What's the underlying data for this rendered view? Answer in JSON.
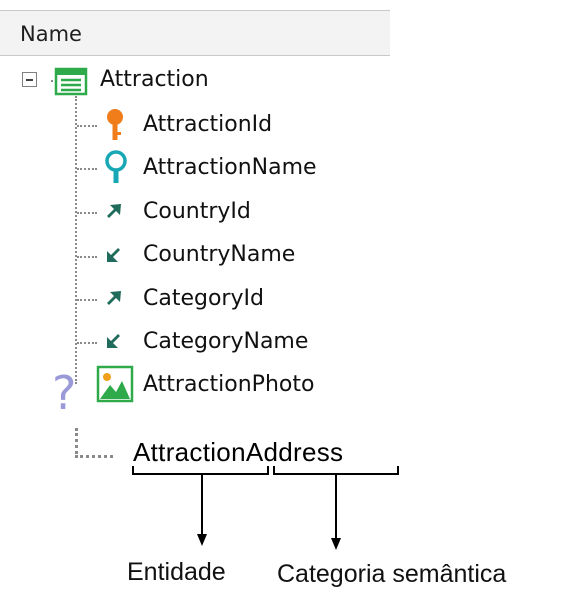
{
  "header": {
    "column_label": "Name"
  },
  "tree": {
    "root": {
      "label": "Attraction",
      "icon": "transaction-icon",
      "expanded": true
    },
    "items": [
      {
        "label": "AttractionId",
        "icon": "key-icon"
      },
      {
        "label": "AttractionName",
        "icon": "search-key-icon"
      },
      {
        "label": "CountryId",
        "icon": "foreign-key-arrow-icon"
      },
      {
        "label": "CountryName",
        "icon": "inferred-arrow-icon"
      },
      {
        "label": "CategoryId",
        "icon": "foreign-key-arrow-icon"
      },
      {
        "label": "CategoryName",
        "icon": "inferred-arrow-icon"
      },
      {
        "label": "AttractionPhoto",
        "icon": "image-icon"
      }
    ],
    "new_attribute": {
      "label": "AttractionAddress",
      "part_entity": "Attraction",
      "part_category": "Address"
    }
  },
  "annotations": {
    "entity_caption": "Entidade",
    "category_caption": "Categoria semântica",
    "question_mark": "?"
  },
  "colors": {
    "key": "#f07d1a",
    "search_key": "#18a7b5",
    "arrow": "#1f6b5c",
    "transaction_icon": "#2eaa4a",
    "question_mark": "#9a9ad8"
  }
}
